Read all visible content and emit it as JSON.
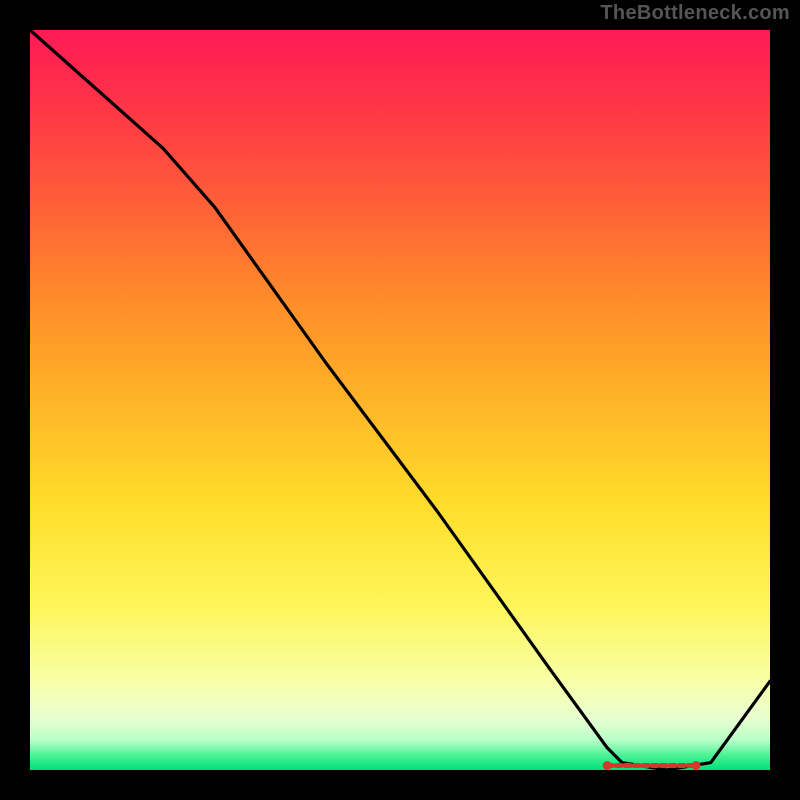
{
  "watermark": "TheBottleneck.com",
  "chart_data": {
    "type": "line",
    "title": "",
    "xlabel": "",
    "ylabel": "",
    "xlim": [
      0,
      100
    ],
    "ylim": [
      0,
      100
    ],
    "grid": false,
    "legend": false,
    "series": [
      {
        "name": "curve",
        "x": [
          0,
          18,
          25,
          40,
          55,
          70,
          78,
          80,
          86,
          92,
          100
        ],
        "values": [
          100,
          84,
          76,
          55,
          35,
          14,
          3,
          1,
          0,
          1,
          12
        ]
      }
    ],
    "highlight_band": {
      "x_start": 78,
      "x_end": 90,
      "y": 0.6
    },
    "gradient_stops": [
      {
        "pos": 0,
        "color": "#ff1a55"
      },
      {
        "pos": 22,
        "color": "#ff5a3a"
      },
      {
        "pos": 50,
        "color": "#ffb427"
      },
      {
        "pos": 78,
        "color": "#fef65a"
      },
      {
        "pos": 93,
        "color": "#e8ffd0"
      },
      {
        "pos": 100,
        "color": "#00e07a"
      }
    ]
  }
}
